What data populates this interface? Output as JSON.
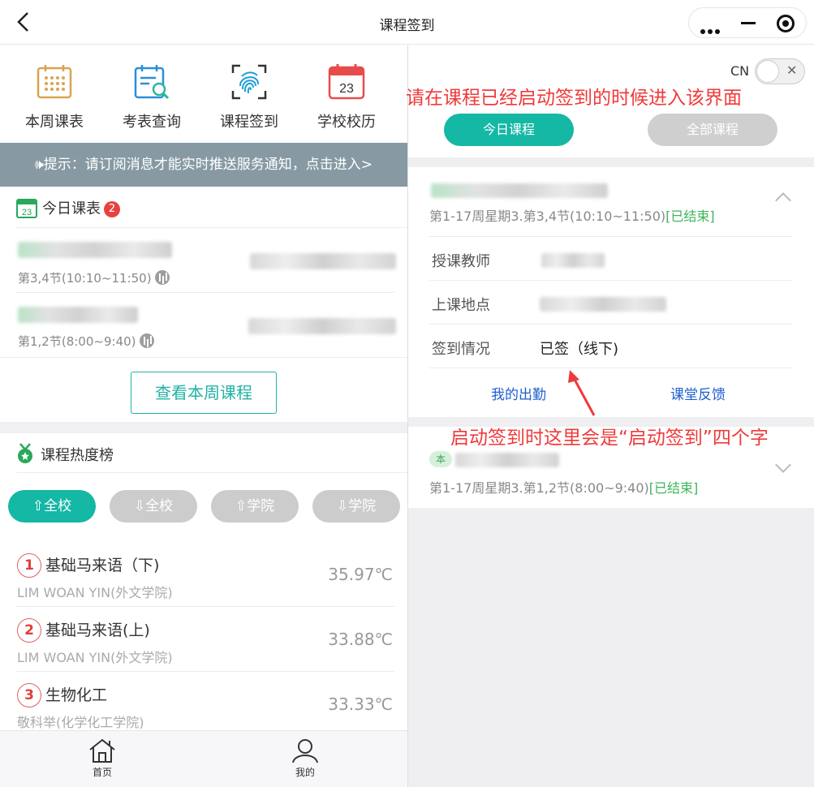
{
  "header": {
    "title": "课程签到"
  },
  "quick_actions": [
    {
      "label": "本周课表",
      "icon": "calendar-grid-icon"
    },
    {
      "label": "考表查询",
      "icon": "exam-search-icon"
    },
    {
      "label": "课程签到",
      "icon": "fingerprint-icon"
    },
    {
      "label": "学校校历",
      "icon": "calendar-23-icon"
    }
  ],
  "notice": "🕪提示：请订阅消息才能实时推送服务通知，点击进入>",
  "today_schedule": {
    "title": "今日课表",
    "badge": "2",
    "calendar_icon_day": "23",
    "courses": [
      {
        "time": "第3,4节(10:10~11:50)"
      },
      {
        "time": "第1,2节(8:00~9:40)"
      }
    ],
    "view_week_button": "查看本周课程"
  },
  "heat_rank": {
    "title": "课程热度榜",
    "filters": [
      {
        "label": "⇧全校",
        "active": true
      },
      {
        "label": "⇩全校",
        "active": false
      },
      {
        "label": "⇧学院",
        "active": false
      },
      {
        "label": "⇩学院",
        "active": false
      }
    ],
    "items": [
      {
        "rank": "1",
        "name": "基础马来语（下)",
        "teacher": "LIM WOAN YIN(外文学院)",
        "score": "35.97℃"
      },
      {
        "rank": "2",
        "name": "基础马来语(上)",
        "teacher": "LIM WOAN YIN(外文学院)",
        "score": "33.88℃"
      },
      {
        "rank": "3",
        "name": "生物化工",
        "teacher": "敬科举(化学化工学院)",
        "score": "33.33℃"
      }
    ]
  },
  "tabbar": [
    {
      "label": "首页",
      "icon": "home-icon"
    },
    {
      "label": "我的",
      "icon": "profile-icon"
    }
  ],
  "right_panel": {
    "lang_label": "CN",
    "toggle_close": "✕",
    "tabs": [
      {
        "label": "今日课程",
        "active": true
      },
      {
        "label": "全部课程",
        "active": false
      }
    ],
    "course1": {
      "meta": "第1-17周星期3.第3,4节(10:10~11:50)",
      "status": "[已结束]",
      "rows": [
        {
          "key": "授课教师"
        },
        {
          "key": "上课地点"
        },
        {
          "key": "签到情况",
          "value": "已签（线下)"
        }
      ],
      "links": [
        "我的出勤",
        "课堂反馈"
      ]
    },
    "course2": {
      "tag": "本",
      "meta": "第1-17周星期3.第1,2节(8:00~9:40)",
      "status": "[已结束]"
    }
  },
  "annotations": {
    "top": "请在课程已经启动签到的时候进入该界面",
    "bottom": "启动签到时这里会是“启动签到”四个字",
    "color": "#f03a3a"
  },
  "colors": {
    "accent": "#15b7a5",
    "notice_bg": "#879aa3",
    "badge": "#e64340"
  }
}
